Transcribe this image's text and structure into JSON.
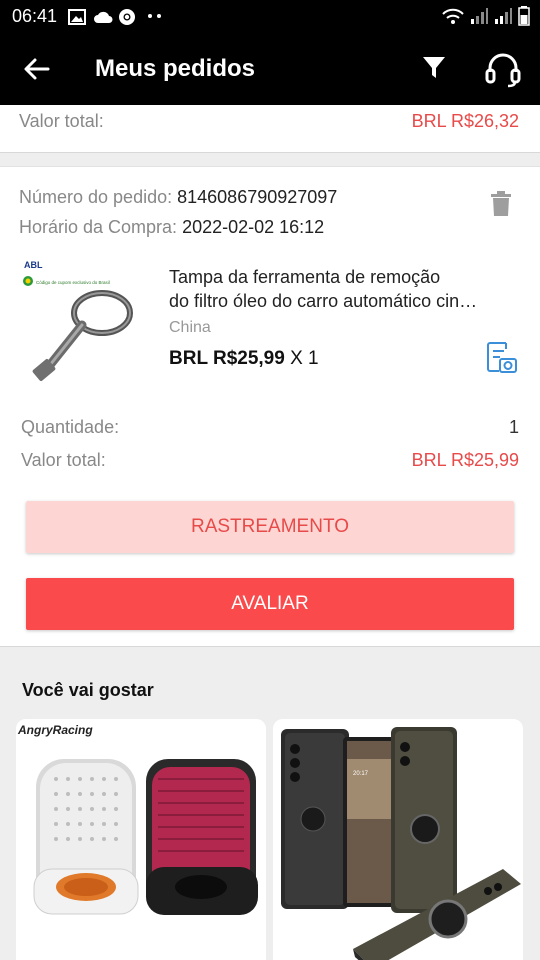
{
  "status_bar": {
    "time": "06:41",
    "icons_left": [
      "image-icon",
      "cloud-icon",
      "chrome-icon",
      "more-dots-icon"
    ],
    "icons_right": [
      "wifi-icon",
      "signal-icon",
      "signal-icon",
      "battery-icon"
    ]
  },
  "app_bar": {
    "title": "Meus pedidos",
    "icons": [
      "back-arrow-icon",
      "filter-icon",
      "headset-icon"
    ]
  },
  "previous_order": {
    "total_label": "Valor total:",
    "total_value": "BRL R$26,32"
  },
  "order": {
    "number_label": "Número do pedido:",
    "number_value": "8146086790927097",
    "time_label": "Horário da Compra:",
    "time_value": "2022-02-02 16:12",
    "product": {
      "image_badge": "ABL",
      "image_caption": "Código de cupom exclusivo do Brasil",
      "title_line1": "Tampa da ferramenta de remoção",
      "title_line2": "do filtro óleo do carro automático cin…",
      "origin": "China",
      "price": "BRL R$25,99",
      "qty": " X 1"
    },
    "quantity_label": "Quantidade:",
    "quantity_value": "1",
    "total_label": "Valor total:",
    "total_value": "BRL R$25,99",
    "track_button": "RASTREAMENTO",
    "rate_button": "AVALIAR"
  },
  "recommendations": {
    "title": "Você vai gostar",
    "items": [
      {
        "brand": "AngryRacing"
      },
      {
        "brand": ""
      }
    ]
  },
  "colors": {
    "accent": "#fa4a4c",
    "accent_light": "#fdd6d3",
    "price_red": "#e84a4a",
    "bar_bg": "#000000"
  }
}
